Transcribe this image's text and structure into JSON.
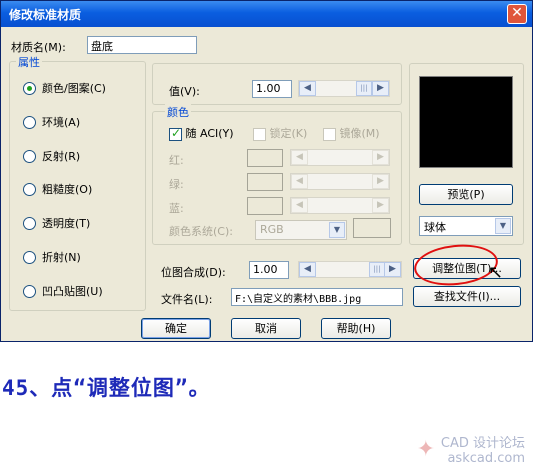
{
  "window": {
    "title": "修改标准材质",
    "close": "✕"
  },
  "material_name": {
    "label": "材质名(M):",
    "value": "盘底"
  },
  "attributes": {
    "legend": "属性",
    "options": [
      {
        "label": "颜色/图案(C)",
        "checked": true
      },
      {
        "label": "环境(A)",
        "checked": false
      },
      {
        "label": "反射(R)",
        "checked": false
      },
      {
        "label": "粗糙度(O)",
        "checked": false
      },
      {
        "label": "透明度(T)",
        "checked": false
      },
      {
        "label": "折射(N)",
        "checked": false
      },
      {
        "label": "凹凸贴图(U)",
        "checked": false
      }
    ]
  },
  "value": {
    "label": "值(V):",
    "value": "1.00"
  },
  "color": {
    "legend": "颜色",
    "by_aci_label": "随 ACI(Y)",
    "lock_label": "锁定(K)",
    "mirror_label": "镜像(M)",
    "red_label": "红:",
    "green_label": "绿:",
    "blue_label": "蓝:",
    "color_system_label": "颜色系统(C):",
    "color_system_value": "RGB"
  },
  "bitmap_blend": {
    "label": "位图合成(D):",
    "value": "1.00"
  },
  "file_name": {
    "label": "文件名(L):",
    "value": "F:\\自定义的素材\\BBB.jpg"
  },
  "preview": {
    "button_label": "预览(P)",
    "shape_value": "球体"
  },
  "adjust_bitmap_label": "调整位图(T)...",
  "find_file_label": "查找文件(I)...",
  "buttons": {
    "ok": "确定",
    "cancel": "取消",
    "help": "帮助(H)"
  },
  "caption": "45、点“调整位图”。",
  "watermark": {
    "line1": "CAD 设计论坛",
    "line2": "askcad.com"
  },
  "colors": {
    "title_bar": "#0a5ee0",
    "dialog_bg": "#ece9d8",
    "highlight": "#e01010",
    "caption": "#1e2ab8"
  }
}
